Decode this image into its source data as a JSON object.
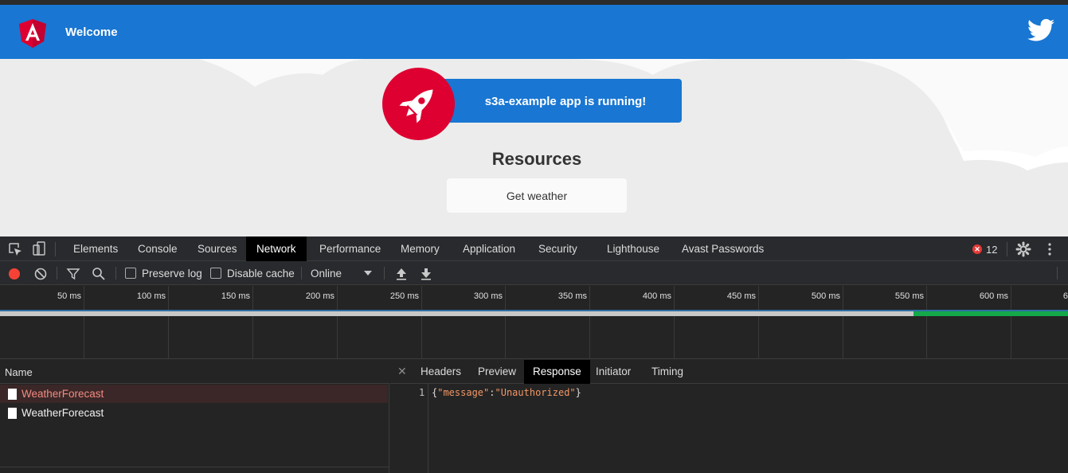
{
  "app": {
    "title": "Welcome",
    "running_text": "s3a-example app is running!",
    "resources_heading": "Resources",
    "get_weather_button": "Get weather",
    "icons": {
      "logo": "angular-logo-icon",
      "social": "twitter-icon",
      "rocket": "rocket-icon"
    },
    "colors": {
      "toolbar": "#1976d2",
      "accent_red": "#dd0031",
      "background": "#ececec"
    }
  },
  "devtools": {
    "tabs": [
      {
        "label": "Elements"
      },
      {
        "label": "Console"
      },
      {
        "label": "Sources"
      },
      {
        "label": "Network",
        "active": true
      },
      {
        "label": "Performance"
      },
      {
        "label": "Memory"
      },
      {
        "label": "Application"
      },
      {
        "label": "Security"
      },
      {
        "label": "Lighthouse"
      },
      {
        "label": "Avast Passwords"
      }
    ],
    "error_count": "12",
    "toolbar": {
      "preserve_log": "Preserve log",
      "disable_cache": "Disable cache",
      "throttling": "Online"
    },
    "timeline_ticks": [
      "50 ms",
      "100 ms",
      "150 ms",
      "200 ms",
      "250 ms",
      "300 ms",
      "350 ms",
      "400 ms",
      "450 ms",
      "500 ms",
      "550 ms",
      "600 ms",
      "6"
    ],
    "name_column": "Name",
    "requests": [
      {
        "name": "WeatherForecast",
        "status": "error"
      },
      {
        "name": "WeatherForecast",
        "status": "ok"
      }
    ],
    "detail_tabs": [
      {
        "label": "Headers"
      },
      {
        "label": "Preview"
      },
      {
        "label": "Response",
        "active": true
      },
      {
        "label": "Initiator"
      },
      {
        "label": "Timing"
      }
    ],
    "response": {
      "line_number": "1",
      "open": "{",
      "key": "\"message\"",
      "colon": ":",
      "value": "\"Unauthorized\"",
      "close": "}"
    }
  }
}
